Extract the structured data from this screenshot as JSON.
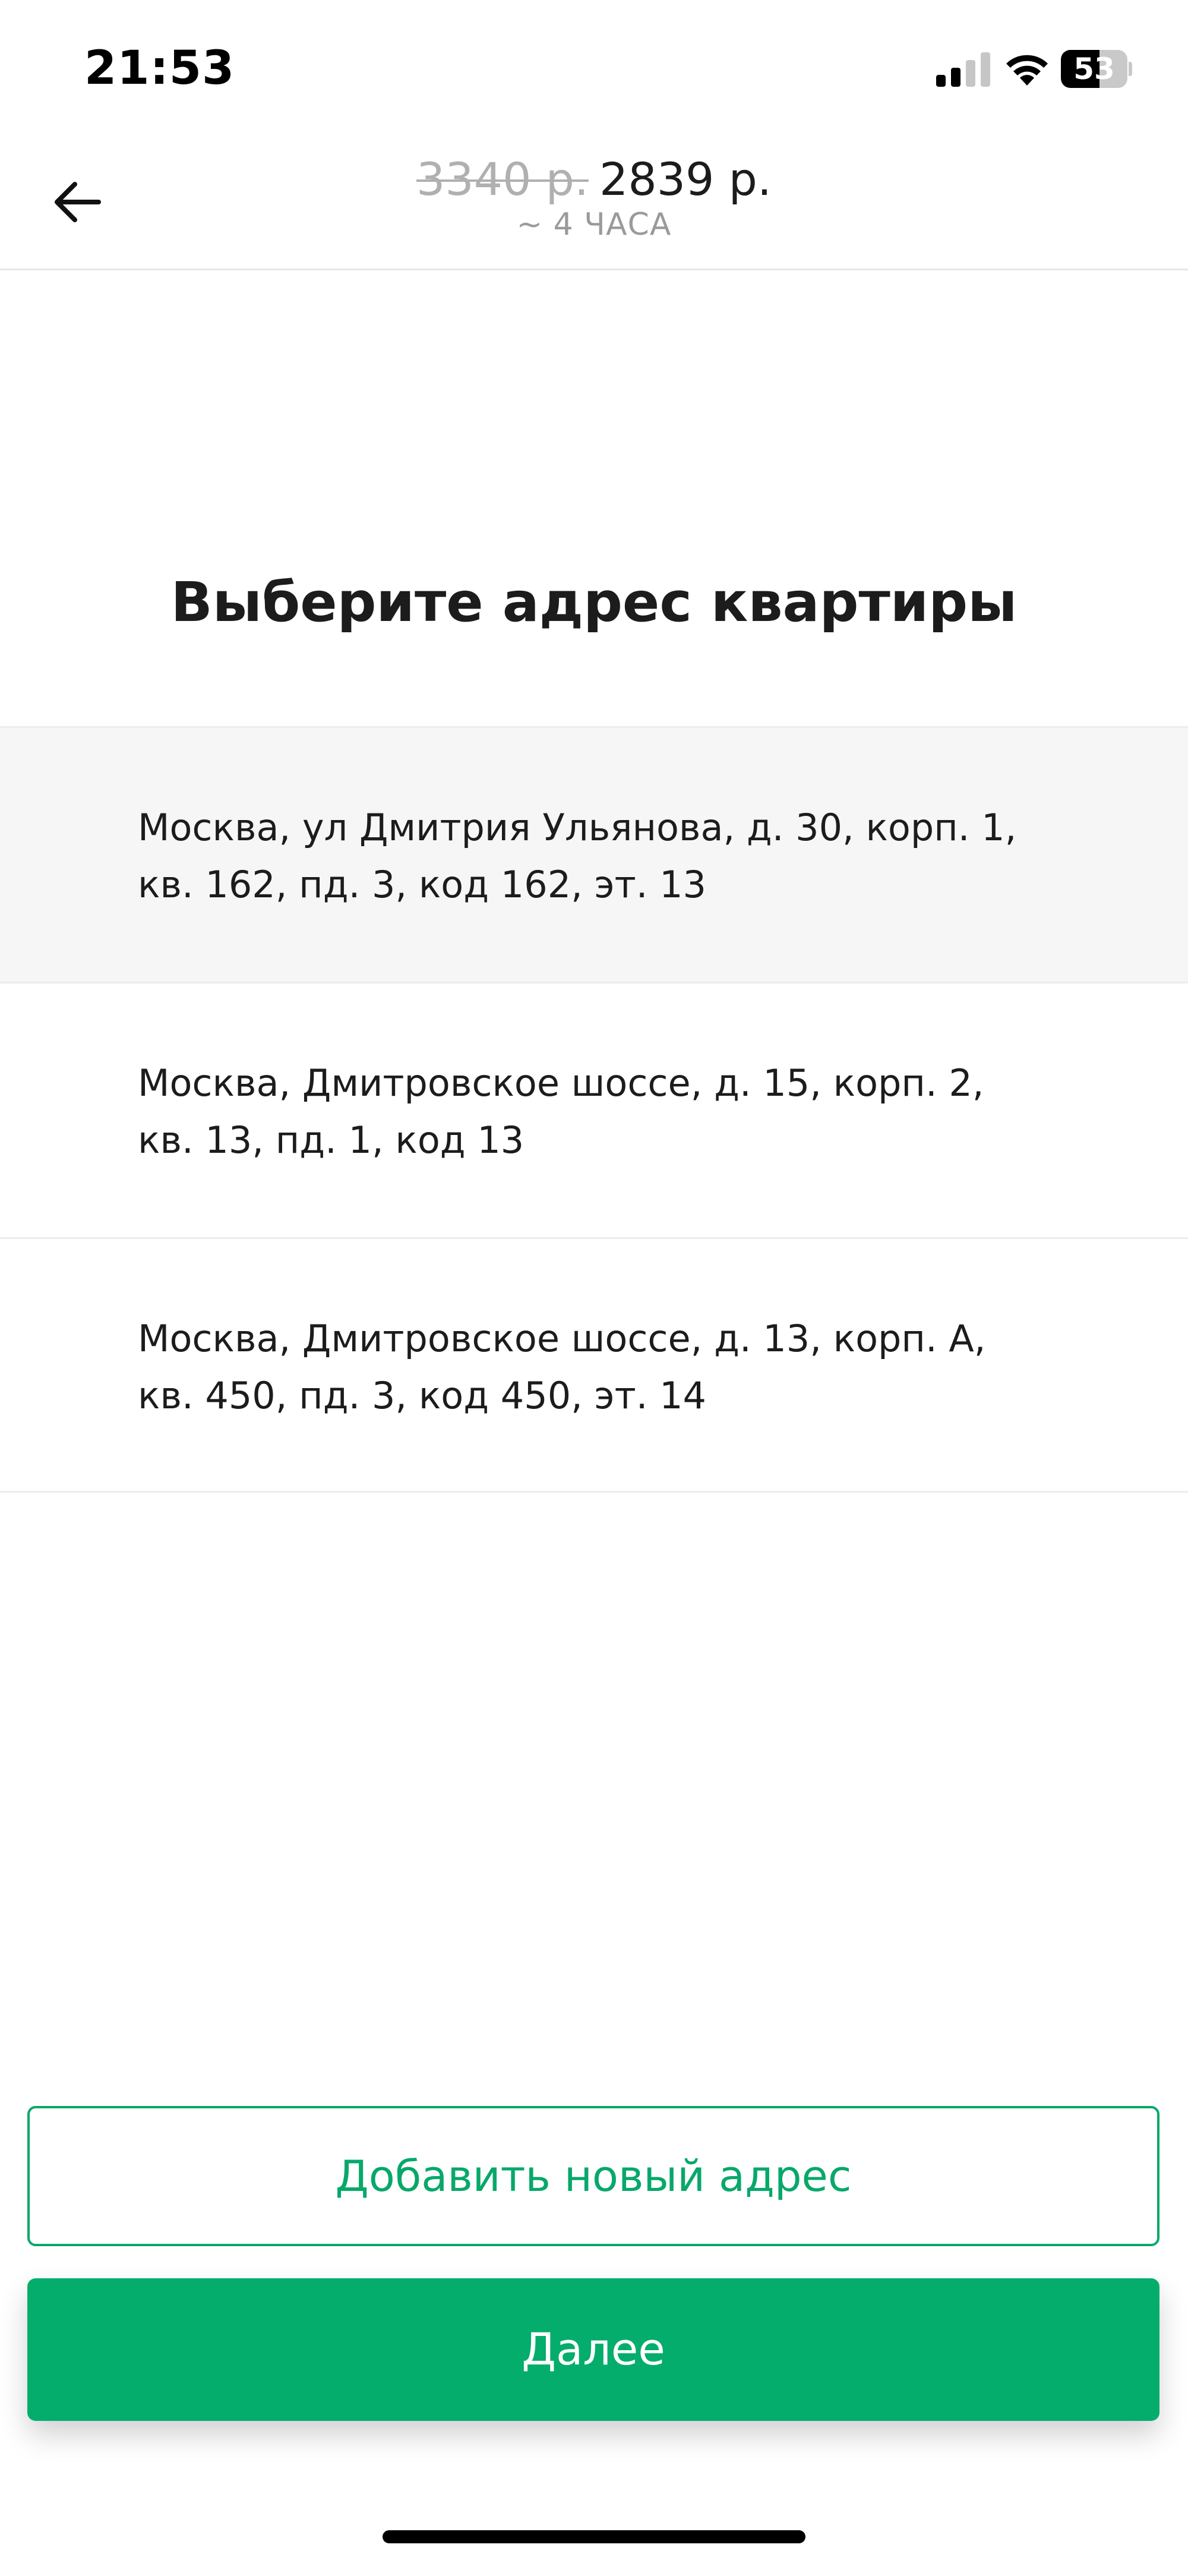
{
  "status_bar": {
    "time": "21:53",
    "battery_level": "53",
    "icons": [
      "signal-icon",
      "wifi-icon",
      "battery-icon"
    ]
  },
  "header": {
    "old_price": "3340 р.",
    "new_price": "2839 р.",
    "duration": "~ 4 ЧАСА",
    "back_icon": "arrow-left-icon"
  },
  "main": {
    "title": "Выберите адрес квартиры",
    "addresses": [
      {
        "text": "Москва, ул Дмитрия Ульянова, д. 30, корп. 1,\nкв. 162, пд. 3, код 162, эт. 13",
        "selected": true
      },
      {
        "text": "Москва, Дмитровское шоссе, д. 15, корп. 2,\nкв. 13, пд. 1, код 13",
        "selected": false
      },
      {
        "text": "Москва, Дмитровское шоссе, д. 13, корп. А,\nкв. 450, пд. 3, код 450, эт. 14",
        "selected": false
      }
    ]
  },
  "actions": {
    "add_address_label": "Добавить новый адрес",
    "next_label": "Далее"
  },
  "colors": {
    "accent": "#04ad6c",
    "selected_row": "#f6f6f6",
    "muted_text": "#9a9a9a"
  }
}
